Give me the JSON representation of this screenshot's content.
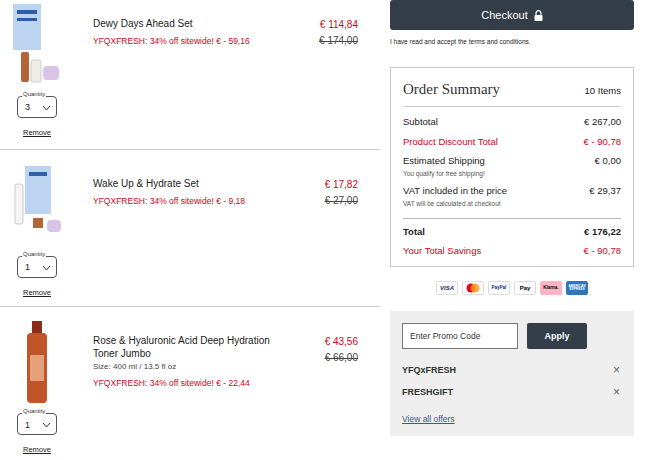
{
  "items": [
    {
      "name": "Dewy Days Ahead Set",
      "price": "€ 114,84",
      "original_price": "€ 174,00",
      "promo": "YFQXFRESH: 34% off sitewide! € - 59,16",
      "quantity_label": "Quantity",
      "quantity": "3",
      "remove": "Remove"
    },
    {
      "name": "Wake Up & Hydrate Set",
      "price": "€ 17,82",
      "original_price": "€ 27,00",
      "promo": "YFQXFRESH: 34% off sitewide! € - 9,18",
      "quantity_label": "Quantity",
      "quantity": "1",
      "remove": "Remove"
    },
    {
      "name": "Rose & Hyaluronic Acid Deep Hydration Toner Jumbo",
      "size": "Size: 400 ml / 13.5 fl oz",
      "price": "€ 43,56",
      "original_price": "€ 66,00",
      "promo": "YFQXFRESH: 34% off sitewide! € - 22,44",
      "quantity_label": "Quantity",
      "quantity": "1",
      "remove": "Remove"
    }
  ],
  "checkout": {
    "label": "Checkout"
  },
  "terms": {
    "prefix": "I have read and accept the ",
    "link": "terms and conditions",
    "suffix": "."
  },
  "summary": {
    "title": "Order Summary",
    "count": "10 Items",
    "rows": [
      {
        "label": "Subtotal",
        "value": "€ 267,00",
        "kind": "normal"
      },
      {
        "label": "Product Discount Total",
        "value": "€ - 90,78",
        "kind": "discount"
      },
      {
        "label": "Estimated Shipping",
        "value": "€ 0,00",
        "note": "You qualify for free shipping!",
        "kind": "normal"
      },
      {
        "label": "VAT included in the price",
        "value": "€ 29,37",
        "note": "VAT will be calculated at checkout",
        "kind": "normal"
      },
      {
        "label": "Total",
        "value": "€ 176,22",
        "kind": "total"
      },
      {
        "label": "Your Total Savings",
        "value": "€ - 90,78",
        "kind": "discount"
      }
    ]
  },
  "payments": [
    {
      "kind": "visa",
      "label": "VISA"
    },
    {
      "kind": "mastercard"
    },
    {
      "kind": "paypal",
      "label": "PayPal"
    },
    {
      "kind": "applepay",
      "label": "Pay"
    },
    {
      "kind": "klarna",
      "label": "Klarna."
    },
    {
      "kind": "amex",
      "label": "AMERICAN EXPRESS"
    }
  ],
  "promo": {
    "placeholder": "Enter Promo Code",
    "apply": "Apply",
    "codes": [
      {
        "code": "YFQxFRESH",
        "remove": "×"
      },
      {
        "code": "FRESHGIFT",
        "remove": "×"
      }
    ],
    "view_all": "View all offers"
  }
}
